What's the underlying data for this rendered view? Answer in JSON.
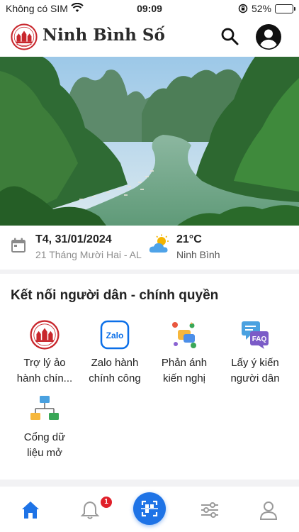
{
  "status_bar": {
    "carrier": "Không có SIM",
    "time": "09:09",
    "battery": "52%",
    "battery_level": 0.52
  },
  "header": {
    "title": "Ninh Bình Số",
    "icons": {
      "logo": "ninh-binh-emblem",
      "search": "search-icon",
      "profile": "user-avatar-icon"
    }
  },
  "info": {
    "date": "T4, 31/01/2024",
    "lunar_date": "21 Tháng Mười Hai - AL",
    "temperature": "21°C",
    "location": "Ninh Bình"
  },
  "connect": {
    "heading": "Kết nối người dân - chính quyền",
    "tiles": [
      {
        "label_1": "Trợ lý ảo",
        "label_2": "hành chín...",
        "icon": "ninh-binh-emblem"
      },
      {
        "label_1": "Zalo hành",
        "label_2": "chính công",
        "icon": "zalo-icon",
        "icon_text": "Zalo"
      },
      {
        "label_1": "Phản ánh",
        "label_2": "kiến nghị",
        "icon": "feedback-icon"
      },
      {
        "label_1": "Lấy ý kiến",
        "label_2": "người dân",
        "icon": "faq-icon",
        "icon_text": "FAQ"
      },
      {
        "label_1": "Cổng dữ",
        "label_2": "liệu mở",
        "icon": "open-data-icon"
      }
    ]
  },
  "bottom_nav": {
    "items": [
      "home-icon",
      "bell-icon",
      "scan-icon",
      "settings-sliders-icon",
      "profile-icon"
    ],
    "notification_count": "1",
    "active": "home-icon"
  },
  "colors": {
    "accent": "#1e73e6",
    "badge": "#e0202a",
    "emblem_red": "#c8262c"
  }
}
